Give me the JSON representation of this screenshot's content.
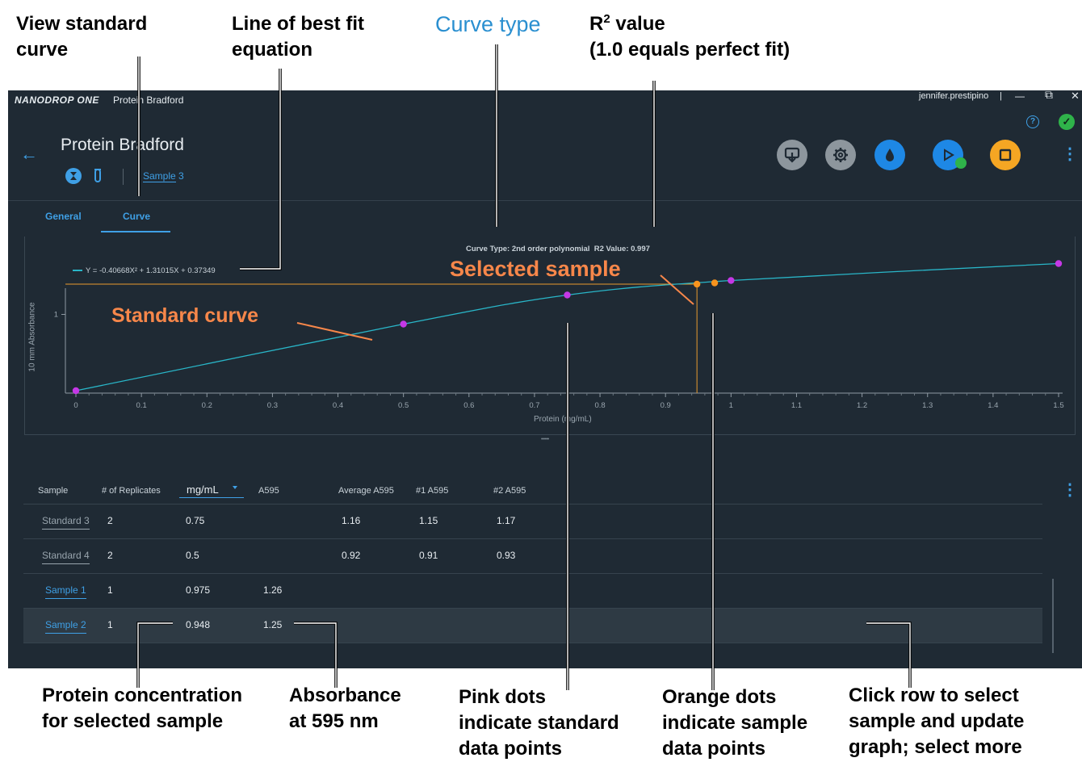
{
  "callouts": {
    "view_curve": "View standard\ncurve",
    "best_fit": "Line of best fit\nequation",
    "curve_type": "Curve type",
    "r2_main": "R",
    "r2_sup": "2",
    "r2_rest": " value",
    "r2_line2": "(1.0 equals perfect fit)",
    "selected_sample": "Selected sample",
    "standard_curve": "Standard curve",
    "protein_conc": "Protein concentration\nfor selected sample",
    "absorbance": "Absorbance\nat 595 nm",
    "pink_dots": "Pink dots\nindicate standard\ndata points",
    "orange_dots": "Orange dots\nindicate sample\ndata points",
    "click_row": "Click row to select\nsample and update\ngraph; select more"
  },
  "titlebar": {
    "brand": "NANODROP ONE",
    "app": "Protein Bradford",
    "user": "jennifer.prestipino",
    "sep": "|",
    "minimize": "—",
    "restore": "⧉",
    "close": "✕"
  },
  "header": {
    "title": "Protein Bradford",
    "sample_label": "Sample",
    "sample_num": "3",
    "back": "←",
    "help": "?",
    "status": "✓",
    "more": "⋮"
  },
  "toolbar": {
    "export_icon": "export-icon",
    "settings_icon": "gear-icon",
    "blank_icon": "droplet-icon",
    "measure_icon": "play-icon",
    "stop_icon": "stop-icon",
    "colors": {
      "gray": "#8d969d",
      "blue": "#1e88e5",
      "orange": "#f5a623"
    }
  },
  "tabs": [
    "General",
    "Curve"
  ],
  "chart_data": {
    "type": "line",
    "header_text": "Curve Type: 2nd order polynomial  R2 Value: 0.997",
    "legend": "Y = -0.40668X² + 1.31015X + 0.37349",
    "xlabel": "Protein (mg/mL)",
    "ylabel": "10 mm Absorbance",
    "xlim": [
      0,
      1.5
    ],
    "ylim": [
      0.35,
      1.35
    ],
    "xticks": [
      "0",
      "0.1",
      "0.2",
      "0.3",
      "0.4",
      "0.5",
      "0.6",
      "0.7",
      "0.8",
      "0.9",
      "1",
      "1.1",
      "1.2",
      "1.3",
      "1.4",
      "1.5"
    ],
    "yticks": [
      "1"
    ],
    "curve": {
      "a": -0.40668,
      "b": 1.31015,
      "c": 0.37349
    },
    "standards": [
      {
        "x": 0,
        "y": 0.37
      },
      {
        "x": 0.5,
        "y": 0.92
      },
      {
        "x": 0.75,
        "y": 1.16
      },
      {
        "x": 1.0,
        "y": 1.28
      },
      {
        "x": 1.5,
        "y": 1.42
      }
    ],
    "samples": [
      {
        "x": 0.948,
        "y": 1.25
      },
      {
        "x": 0.975,
        "y": 1.26
      }
    ],
    "selected": {
      "x": 0.948,
      "y": 1.25
    },
    "colors": {
      "curve": "#29b6c8",
      "standard": "#c438e6",
      "sample": "#f7941d",
      "guide": "#e89a2e"
    }
  },
  "table": {
    "headers": [
      "Sample",
      "# of Replicates",
      "mg/mL",
      "A595",
      "Average A595",
      "#1 A595",
      "#2 A595"
    ],
    "rows": [
      {
        "name": "Standard 3",
        "replicates": "2",
        "conc": "0.75",
        "a595": "",
        "avg": "1.16",
        "r1": "1.15",
        "r2": "1.17"
      },
      {
        "name": "Standard 4",
        "replicates": "2",
        "conc": "0.5",
        "a595": "",
        "avg": "0.92",
        "r1": "0.91",
        "r2": "0.93"
      },
      {
        "name": "Sample 1",
        "replicates": "1",
        "conc": "0.975",
        "a595": "1.26",
        "avg": "",
        "r1": "",
        "r2": ""
      },
      {
        "name": "Sample 2",
        "replicates": "1",
        "conc": "0.948",
        "a595": "1.25",
        "avg": "",
        "r1": "",
        "r2": ""
      }
    ]
  }
}
